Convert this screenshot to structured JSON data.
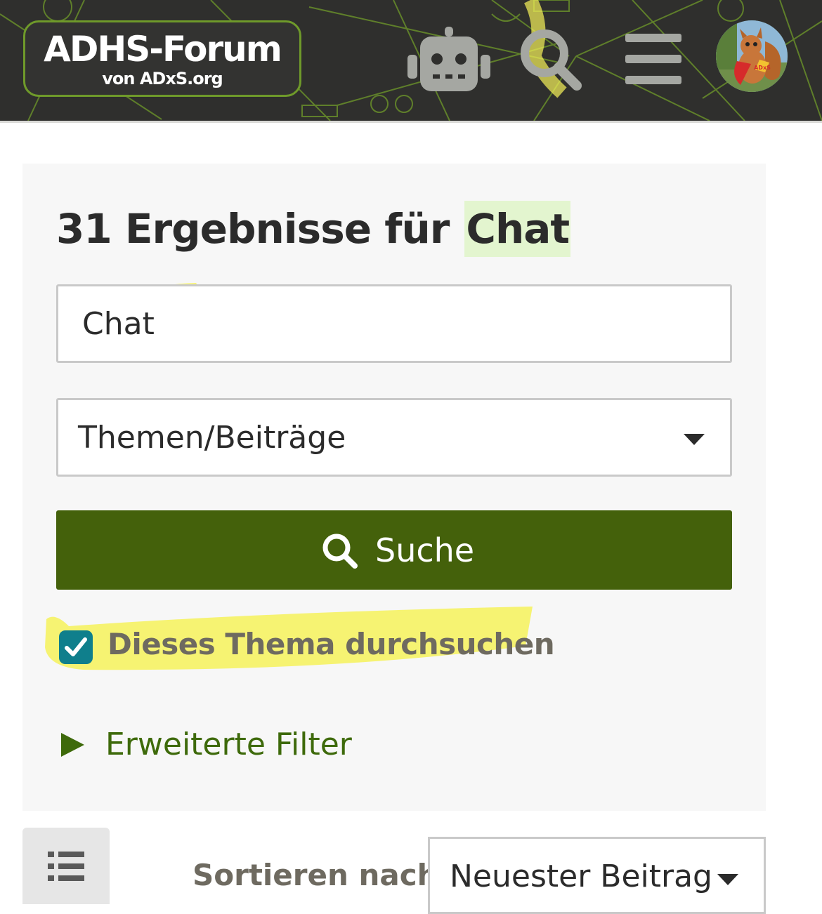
{
  "header": {
    "logo_title": "ADHS-Forum",
    "logo_subtitle": "von ADxS.org",
    "icons": [
      "robot-icon",
      "search-icon",
      "hamburger-menu-icon",
      "user-avatar"
    ],
    "avatar_badge": "ADxS"
  },
  "search": {
    "result_count_text": "31 Ergebnisse für",
    "search_term": "Chat",
    "query_value": "Chat",
    "scope_select_value": "Themen/Beiträge",
    "search_button_label": "Suche",
    "this_topic_checkbox_label": "Dieses Thema durchsuchen",
    "this_topic_checked": true,
    "advanced_filters_label": "Erweiterte Filter"
  },
  "sort": {
    "label": "Sortieren nach",
    "value": "Neuester Beitrag"
  },
  "colors": {
    "header_bg": "#2f2f2d",
    "accent_green": "#44610b",
    "link_green": "#3e6a0b",
    "checkbox_teal": "#0f7f8c",
    "marker_yellow": "#f6f25a",
    "term_highlight": "#e3f5cf"
  }
}
